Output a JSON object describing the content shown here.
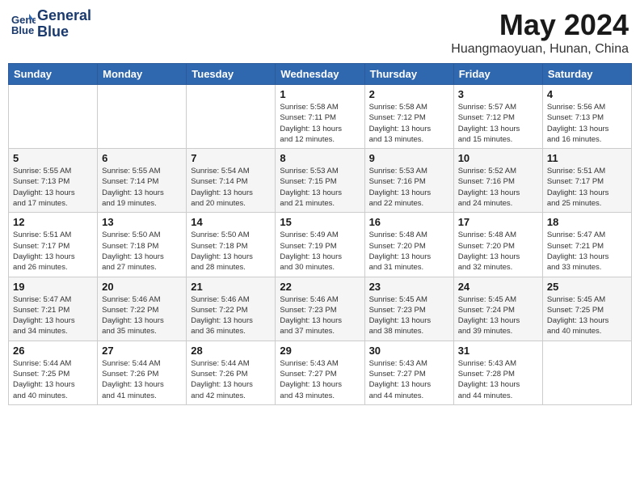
{
  "header": {
    "logo_line1": "General",
    "logo_line2": "Blue",
    "title": "May 2024",
    "subtitle": "Huangmaoyuan, Hunan, China"
  },
  "days_of_week": [
    "Sunday",
    "Monday",
    "Tuesday",
    "Wednesday",
    "Thursday",
    "Friday",
    "Saturday"
  ],
  "weeks": [
    {
      "days": [
        {
          "num": "",
          "info": ""
        },
        {
          "num": "",
          "info": ""
        },
        {
          "num": "",
          "info": ""
        },
        {
          "num": "1",
          "info": "Sunrise: 5:58 AM\nSunset: 7:11 PM\nDaylight: 13 hours\nand 12 minutes."
        },
        {
          "num": "2",
          "info": "Sunrise: 5:58 AM\nSunset: 7:12 PM\nDaylight: 13 hours\nand 13 minutes."
        },
        {
          "num": "3",
          "info": "Sunrise: 5:57 AM\nSunset: 7:12 PM\nDaylight: 13 hours\nand 15 minutes."
        },
        {
          "num": "4",
          "info": "Sunrise: 5:56 AM\nSunset: 7:13 PM\nDaylight: 13 hours\nand 16 minutes."
        }
      ]
    },
    {
      "days": [
        {
          "num": "5",
          "info": "Sunrise: 5:55 AM\nSunset: 7:13 PM\nDaylight: 13 hours\nand 17 minutes."
        },
        {
          "num": "6",
          "info": "Sunrise: 5:55 AM\nSunset: 7:14 PM\nDaylight: 13 hours\nand 19 minutes."
        },
        {
          "num": "7",
          "info": "Sunrise: 5:54 AM\nSunset: 7:14 PM\nDaylight: 13 hours\nand 20 minutes."
        },
        {
          "num": "8",
          "info": "Sunrise: 5:53 AM\nSunset: 7:15 PM\nDaylight: 13 hours\nand 21 minutes."
        },
        {
          "num": "9",
          "info": "Sunrise: 5:53 AM\nSunset: 7:16 PM\nDaylight: 13 hours\nand 22 minutes."
        },
        {
          "num": "10",
          "info": "Sunrise: 5:52 AM\nSunset: 7:16 PM\nDaylight: 13 hours\nand 24 minutes."
        },
        {
          "num": "11",
          "info": "Sunrise: 5:51 AM\nSunset: 7:17 PM\nDaylight: 13 hours\nand 25 minutes."
        }
      ]
    },
    {
      "days": [
        {
          "num": "12",
          "info": "Sunrise: 5:51 AM\nSunset: 7:17 PM\nDaylight: 13 hours\nand 26 minutes."
        },
        {
          "num": "13",
          "info": "Sunrise: 5:50 AM\nSunset: 7:18 PM\nDaylight: 13 hours\nand 27 minutes."
        },
        {
          "num": "14",
          "info": "Sunrise: 5:50 AM\nSunset: 7:18 PM\nDaylight: 13 hours\nand 28 minutes."
        },
        {
          "num": "15",
          "info": "Sunrise: 5:49 AM\nSunset: 7:19 PM\nDaylight: 13 hours\nand 30 minutes."
        },
        {
          "num": "16",
          "info": "Sunrise: 5:48 AM\nSunset: 7:20 PM\nDaylight: 13 hours\nand 31 minutes."
        },
        {
          "num": "17",
          "info": "Sunrise: 5:48 AM\nSunset: 7:20 PM\nDaylight: 13 hours\nand 32 minutes."
        },
        {
          "num": "18",
          "info": "Sunrise: 5:47 AM\nSunset: 7:21 PM\nDaylight: 13 hours\nand 33 minutes."
        }
      ]
    },
    {
      "days": [
        {
          "num": "19",
          "info": "Sunrise: 5:47 AM\nSunset: 7:21 PM\nDaylight: 13 hours\nand 34 minutes."
        },
        {
          "num": "20",
          "info": "Sunrise: 5:46 AM\nSunset: 7:22 PM\nDaylight: 13 hours\nand 35 minutes."
        },
        {
          "num": "21",
          "info": "Sunrise: 5:46 AM\nSunset: 7:22 PM\nDaylight: 13 hours\nand 36 minutes."
        },
        {
          "num": "22",
          "info": "Sunrise: 5:46 AM\nSunset: 7:23 PM\nDaylight: 13 hours\nand 37 minutes."
        },
        {
          "num": "23",
          "info": "Sunrise: 5:45 AM\nSunset: 7:23 PM\nDaylight: 13 hours\nand 38 minutes."
        },
        {
          "num": "24",
          "info": "Sunrise: 5:45 AM\nSunset: 7:24 PM\nDaylight: 13 hours\nand 39 minutes."
        },
        {
          "num": "25",
          "info": "Sunrise: 5:45 AM\nSunset: 7:25 PM\nDaylight: 13 hours\nand 40 minutes."
        }
      ]
    },
    {
      "days": [
        {
          "num": "26",
          "info": "Sunrise: 5:44 AM\nSunset: 7:25 PM\nDaylight: 13 hours\nand 40 minutes."
        },
        {
          "num": "27",
          "info": "Sunrise: 5:44 AM\nSunset: 7:26 PM\nDaylight: 13 hours\nand 41 minutes."
        },
        {
          "num": "28",
          "info": "Sunrise: 5:44 AM\nSunset: 7:26 PM\nDaylight: 13 hours\nand 42 minutes."
        },
        {
          "num": "29",
          "info": "Sunrise: 5:43 AM\nSunset: 7:27 PM\nDaylight: 13 hours\nand 43 minutes."
        },
        {
          "num": "30",
          "info": "Sunrise: 5:43 AM\nSunset: 7:27 PM\nDaylight: 13 hours\nand 44 minutes."
        },
        {
          "num": "31",
          "info": "Sunrise: 5:43 AM\nSunset: 7:28 PM\nDaylight: 13 hours\nand 44 minutes."
        },
        {
          "num": "",
          "info": ""
        }
      ]
    }
  ]
}
